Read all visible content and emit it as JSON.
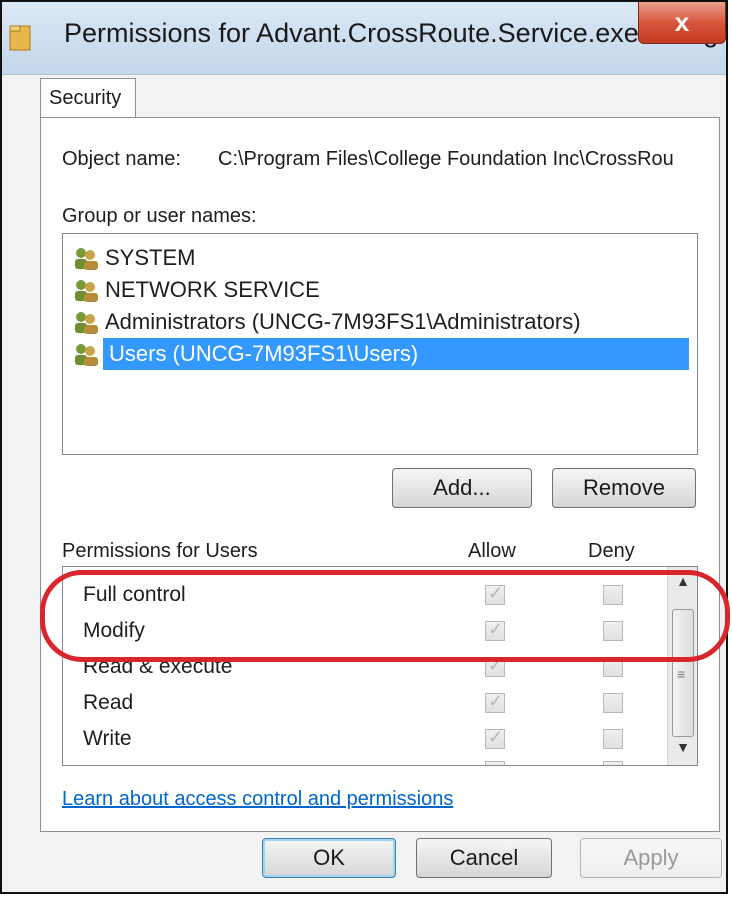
{
  "window": {
    "title": "Permissions for Advant.CrossRoute.Service.exe.config",
    "close_label": "x"
  },
  "tabs": [
    {
      "label": "Security"
    }
  ],
  "security": {
    "object_name_label": "Object name:",
    "object_name_value": "C:\\Program Files\\College Foundation Inc\\CrossRou",
    "group_label": "Group or user names:",
    "users": [
      {
        "name": "SYSTEM",
        "selected": false
      },
      {
        "name": "NETWORK SERVICE",
        "selected": false
      },
      {
        "name": "Administrators (UNCG-7M93FS1\\Administrators)",
        "selected": false
      },
      {
        "name": "Users (UNCG-7M93FS1\\Users)",
        "selected": true
      }
    ],
    "add_label": "Add...",
    "remove_label": "Remove",
    "permissions_label": "Permissions for Users",
    "allow_header": "Allow",
    "deny_header": "Deny",
    "permissions": [
      {
        "name": "Full control",
        "allow": true,
        "deny": false
      },
      {
        "name": "Modify",
        "allow": true,
        "deny": false
      },
      {
        "name": "Read & execute",
        "allow": true,
        "deny": false
      },
      {
        "name": "Read",
        "allow": true,
        "deny": false
      },
      {
        "name": "Write",
        "allow": true,
        "deny": false
      }
    ],
    "learn_link": "Learn about access control and permissions"
  },
  "footer": {
    "ok_label": "OK",
    "cancel_label": "Cancel",
    "apply_label": "Apply"
  },
  "colors": {
    "selection": "#3399ff",
    "highlight_ring": "#d9262c",
    "link": "#0066cc"
  }
}
